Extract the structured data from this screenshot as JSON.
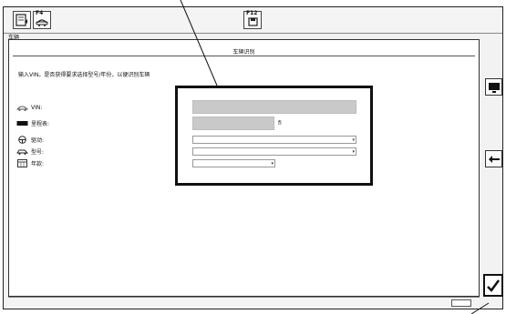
{
  "toolbar": {
    "f4_label": "F4",
    "f12_label": "F12"
  },
  "window": {
    "title": "车辆"
  },
  "panel": {
    "title": "车辆识别",
    "instruction": "输入VIN。是否获得要求选择型号/年份，以便识别车辆"
  },
  "fields": [
    {
      "label": "VIN:",
      "icon": "car-outline-icon"
    },
    {
      "label": "里程表:",
      "icon": "odometer-icon",
      "unit": "fi"
    },
    {
      "label": "驱动:",
      "icon": "steering-wheel-icon"
    },
    {
      "label": "型号:",
      "icon": "car-side-icon"
    },
    {
      "label": "年款:",
      "icon": "calendar-icon"
    }
  ],
  "side_buttons": [
    {
      "icon": "display-icon"
    },
    {
      "icon": "back-arrow-icon"
    }
  ],
  "confirm": {
    "icon": "checkmark-icon"
  }
}
